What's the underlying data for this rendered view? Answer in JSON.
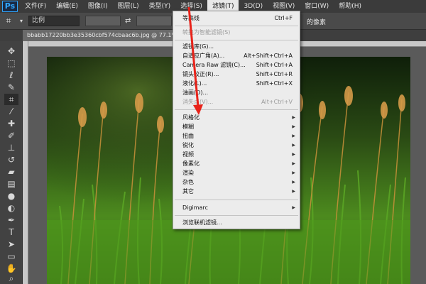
{
  "app": {
    "logo": "Ps"
  },
  "menubar": {
    "items": [
      {
        "label": "文件(F)"
      },
      {
        "label": "编辑(E)"
      },
      {
        "label": "图像(I)"
      },
      {
        "label": "图层(L)"
      },
      {
        "label": "类型(Y)"
      },
      {
        "label": "选择(S)"
      },
      {
        "label": "滤镜(T)"
      },
      {
        "label": "3D(D)"
      },
      {
        "label": "视图(V)"
      },
      {
        "label": "窗口(W)"
      },
      {
        "label": "帮助(H)"
      }
    ],
    "active_label": "滤镜(T)"
  },
  "options_bar": {
    "ratio_value": "比例",
    "right_text": "的像素"
  },
  "document": {
    "tab_title": "bbabb17220bb3e35360cbf574cbaac6b.jpg @ 77.1% (x_la"
  },
  "filter_menu": {
    "items": [
      {
        "label": "等高线",
        "shortcut": "Ctrl+F",
        "disabled": false,
        "submenu": false
      },
      {
        "label": "转换为智能滤镜(S)",
        "shortcut": "",
        "disabled": true,
        "submenu": false
      },
      {
        "label": "滤镜库(G)...",
        "shortcut": "",
        "disabled": false,
        "submenu": false
      },
      {
        "label": "自适应广角(A)...",
        "shortcut": "Alt+Shift+Ctrl+A",
        "disabled": false,
        "submenu": false
      },
      {
        "label": "Camera Raw 滤镜(C)...",
        "shortcut": "Shift+Ctrl+A",
        "disabled": false,
        "submenu": false
      },
      {
        "label": "镜头校正(R)...",
        "shortcut": "Shift+Ctrl+R",
        "disabled": false,
        "submenu": false
      },
      {
        "label": "液化(L)...",
        "shortcut": "Shift+Ctrl+X",
        "disabled": false,
        "submenu": false
      },
      {
        "label": "油画(O)...",
        "shortcut": "",
        "disabled": false,
        "submenu": false
      },
      {
        "label": "消失点(V)...",
        "shortcut": "Alt+Ctrl+V",
        "disabled": true,
        "submenu": false
      },
      {
        "label": "风格化",
        "shortcut": "",
        "disabled": false,
        "submenu": true
      },
      {
        "label": "模糊",
        "shortcut": "",
        "disabled": false,
        "submenu": true
      },
      {
        "label": "扭曲",
        "shortcut": "",
        "disabled": false,
        "submenu": true
      },
      {
        "label": "锐化",
        "shortcut": "",
        "disabled": false,
        "submenu": true
      },
      {
        "label": "视频",
        "shortcut": "",
        "disabled": false,
        "submenu": true
      },
      {
        "label": "像素化",
        "shortcut": "",
        "disabled": false,
        "submenu": true
      },
      {
        "label": "渲染",
        "shortcut": "",
        "disabled": false,
        "submenu": true
      },
      {
        "label": "杂色",
        "shortcut": "",
        "disabled": false,
        "submenu": true
      },
      {
        "label": "其它",
        "shortcut": "",
        "disabled": false,
        "submenu": true
      },
      {
        "label": "Digimarc",
        "shortcut": "",
        "disabled": false,
        "submenu": true
      },
      {
        "label": "浏览联机滤镜...",
        "shortcut": "",
        "disabled": false,
        "submenu": false
      }
    ]
  },
  "toolbox": {
    "tools": [
      "move-icon",
      "marquee-icon",
      "lasso-icon",
      "quick-select-icon",
      "crop-icon",
      "eyedropper-icon",
      "healing-brush-icon",
      "brush-icon",
      "clone-stamp-icon",
      "history-brush-icon",
      "eraser-icon",
      "gradient-icon",
      "blur-icon",
      "dodge-icon",
      "pen-icon",
      "type-icon",
      "path-select-icon",
      "shape-icon",
      "hand-icon",
      "zoom-icon"
    ],
    "selected": "crop-icon"
  },
  "colors": {
    "accent": "#31a8ff",
    "menu_bg": "#ececec",
    "arrow": "#e8231a"
  }
}
